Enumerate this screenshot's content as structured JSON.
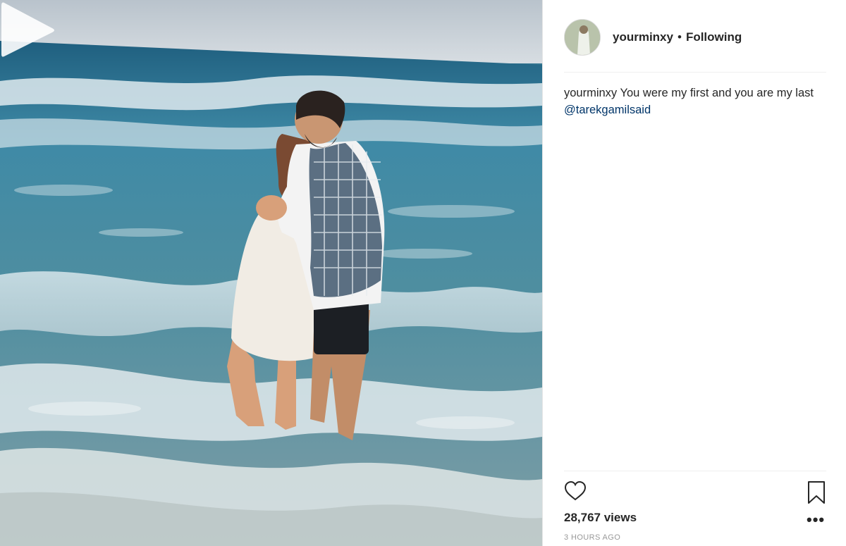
{
  "post": {
    "username": "yourminxy",
    "separator": "•",
    "follow_status": "Following",
    "caption": {
      "username": "yourminxy",
      "text": " You were my first and you are my last ",
      "mention": "@tarekgamilsaid"
    },
    "views": "28,767 views",
    "time": "3 HOURS AGO",
    "more": "•••"
  },
  "icons": {
    "play": "play-icon",
    "like": "heart-icon",
    "save": "bookmark-icon",
    "more": "more-options-icon"
  }
}
